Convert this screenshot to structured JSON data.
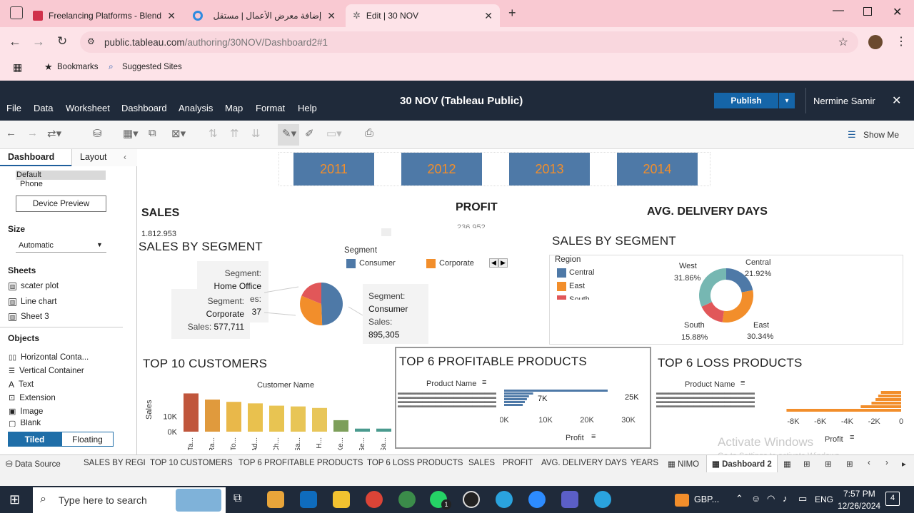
{
  "browser": {
    "tabs": [
      {
        "title": "Freelancing Platforms - Blended",
        "active": false
      },
      {
        "title": "إضافة معرض الأعمال | مستقل",
        "active": false
      },
      {
        "title": "Edit | 30 NOV",
        "active": true
      }
    ],
    "url_host": "public.tableau.com",
    "url_path": "/authoring/30NOV/Dashboard2#1",
    "bookmarks": [
      "Bookmarks",
      "Suggested Sites"
    ]
  },
  "tableau": {
    "menu": [
      "File",
      "Data",
      "Worksheet",
      "Dashboard",
      "Analysis",
      "Map",
      "Format",
      "Help"
    ],
    "title": "30 NOV (Tableau Public)",
    "publish_label": "Publish",
    "user": "Nermine Samir",
    "show_me": "Show Me"
  },
  "left_pane": {
    "tabs": [
      "Dashboard",
      "Layout"
    ],
    "device_options": [
      "Default",
      "Phone"
    ],
    "device_preview": "Device Preview",
    "size_label": "Size",
    "size_value": "Automatic",
    "sheets_label": "Sheets",
    "sheets": [
      "scater plot",
      "Line chart",
      "Sheet 3"
    ],
    "objects_label": "Objects",
    "objects": [
      "Horizontal Conta...",
      "Vertical Container",
      "Text",
      "Extension",
      "Image",
      "Blank"
    ],
    "tiled": "Tiled",
    "floating": "Floating"
  },
  "dashboard": {
    "years": [
      "2011",
      "2012",
      "2013",
      "2014"
    ],
    "sales_title": "SALES",
    "sales_value": "1.812.953",
    "profit_title": "PROFIT",
    "profit_value": "236.952",
    "avg_title": "AVG. DELIVERY DAYS",
    "seg_title_left": "SALES BY SEGMENT",
    "seg_title_right": "SALES BY SEGMENT",
    "segment_legend_title": "Segment",
    "region_legend_title": "Region",
    "top10_title": "TOP 10 CUSTOMERS",
    "top6p_title": "TOP 6 PROFITABLE PRODUCTS",
    "top6l_title": "TOP 6 LOSS PRODUCTS",
    "customer_name_label": "Customer Name",
    "product_name_label": "Product Name",
    "profit_axis_label": "Profit",
    "sales_axis_label": "Sales",
    "tooltip_home": {
      "k1": "Segment:",
      "v1": "Home Office",
      "k2": "es:",
      "v2": "37"
    },
    "tooltip_corp": {
      "k1": "Segment:",
      "v1": "Corporate",
      "k2": "Sales:",
      "v2": "577,711"
    },
    "tooltip_cons": {
      "k1": "Segment:",
      "v1": "Consumer",
      "k2": "Sales:",
      "v2": "895,305"
    },
    "watermark1": "Activate Windows",
    "watermark2": "Go to Settings to activate Windows."
  },
  "chart_data": [
    {
      "type": "pie",
      "title": "SALES BY SEGMENT",
      "categories": [
        "Consumer",
        "Corporate",
        "Home Office"
      ],
      "values": [
        895305,
        577711,
        339937
      ],
      "colors": [
        "#4e79a7",
        "#f28e2b",
        "#e15759"
      ]
    },
    {
      "type": "pie",
      "title": "SALES BY SEGMENT",
      "categories": [
        "Central",
        "East",
        "South",
        "West"
      ],
      "labels": [
        "21.92%",
        "30.34%",
        "15.88%",
        "31.86%"
      ],
      "values": [
        21.92,
        30.34,
        15.88,
        31.86
      ],
      "colors": [
        "#4e79a7",
        "#f28e2b",
        "#e15759",
        "#76b7b2"
      ]
    },
    {
      "type": "bar",
      "title": "TOP 10 CUSTOMERS",
      "xlabel": "Customer Name",
      "ylabel": "Sales",
      "categories": [
        "Ta...",
        "Ra...",
        "To...",
        "Ad...",
        "Ch...",
        "Sa...",
        "H...",
        "Ke...",
        "Se...",
        "Sa..."
      ],
      "values": [
        25000,
        21000,
        19500,
        18500,
        17000,
        16500,
        15500,
        7500,
        2000,
        2000
      ],
      "yticks": [
        "10K",
        "0K"
      ],
      "ylim": [
        0,
        28000
      ]
    },
    {
      "type": "bar",
      "title": "TOP 6 PROFITABLE PRODUCTS",
      "xlabel": "Profit",
      "values": [
        25000,
        7000,
        6000,
        5500,
        5000,
        4500
      ],
      "data_labels": [
        "25K",
        "7K"
      ],
      "xticks": [
        "0K",
        "10K",
        "20K",
        "30K"
      ],
      "xlim": [
        0,
        30000
      ]
    },
    {
      "type": "bar",
      "title": "TOP 6 LOSS PRODUCTS",
      "xlabel": "Profit",
      "values": [
        -1500,
        -1700,
        -1900,
        -2200,
        -3000,
        -8500
      ],
      "xticks": [
        "-8K",
        "-6K",
        "-4K",
        "-2K",
        "0"
      ],
      "xlim": [
        -9000,
        0
      ]
    }
  ],
  "sheet_tabs": [
    "Data Source",
    "SALES BY REGI",
    "TOP 10 CUSTOMERS",
    "TOP 6 PROFITABLE PRODUCTS",
    "TOP 6 LOSS PRODUCTS",
    "SALES",
    "PROFIT",
    "AVG. DELIVERY DAYS",
    "YEARS",
    "NIMO",
    "Dashboard 2"
  ],
  "taskbar": {
    "search_placeholder": "Type here to search",
    "gbp": "GBP...",
    "lang": "ENG",
    "time": "7:57 PM",
    "date": "12/26/2024",
    "notif_count": "4"
  }
}
